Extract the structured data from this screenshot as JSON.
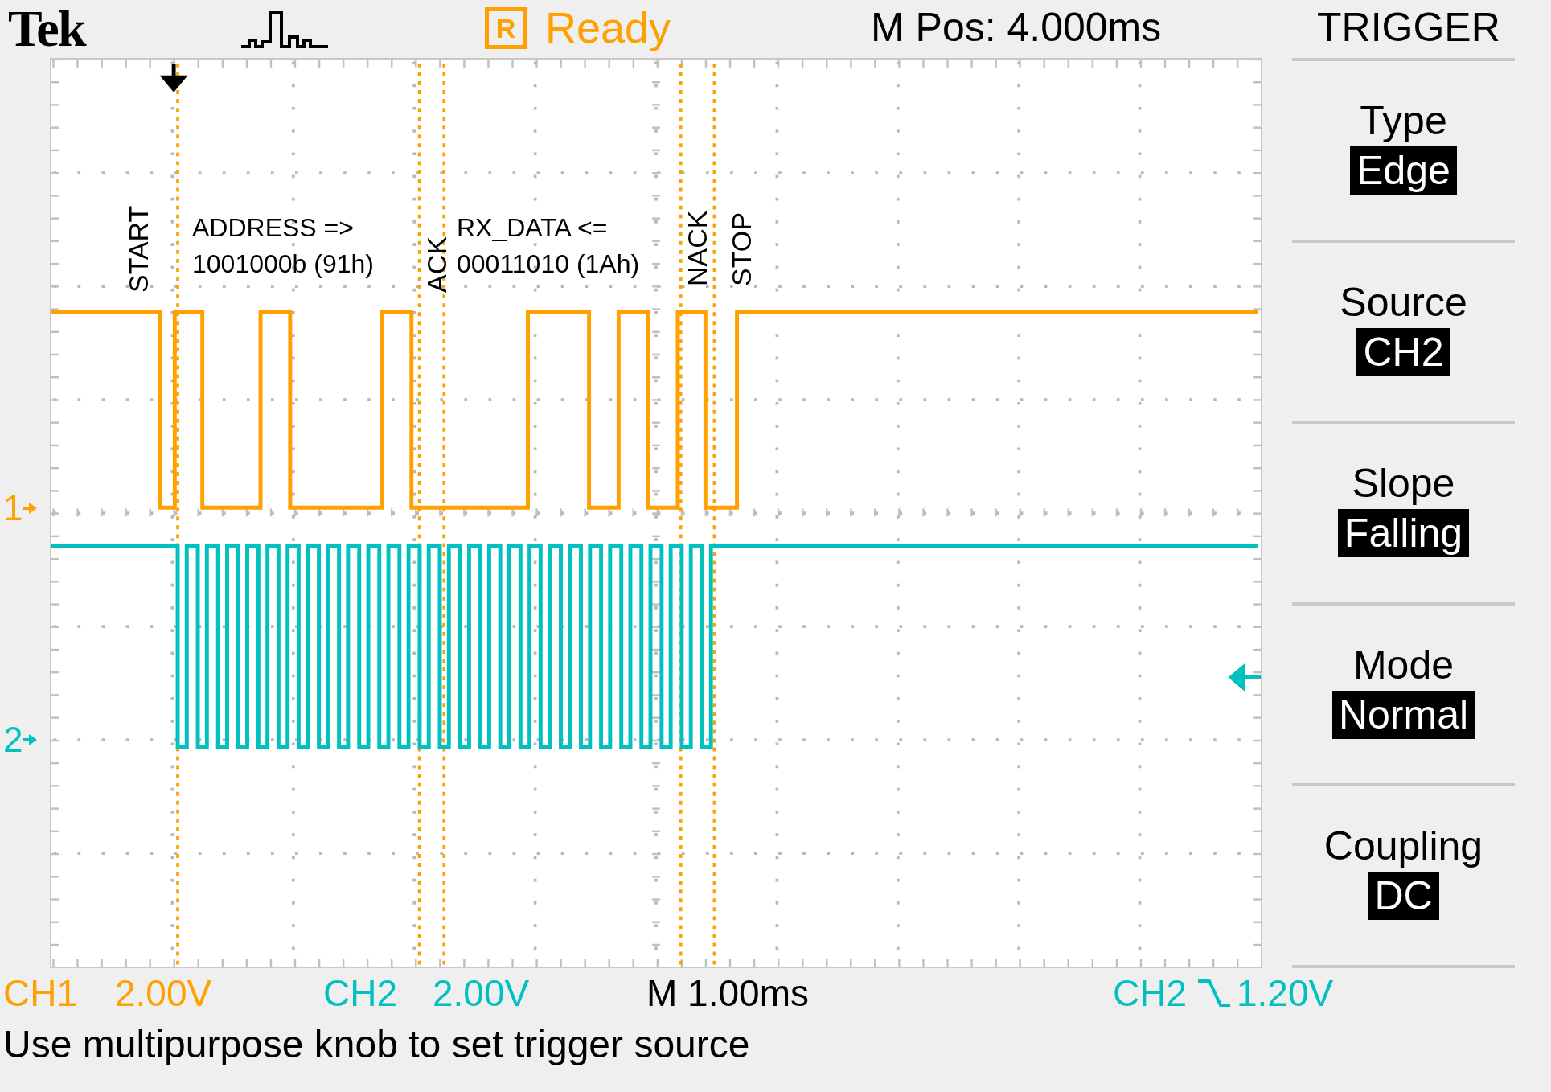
{
  "header": {
    "brand": "Tek",
    "run_badge": "R",
    "status": "Ready",
    "position": "M Pos: 4.000ms",
    "menu_title": "TRIGGER"
  },
  "annotations": [
    {
      "kind": "vertical",
      "lines": [
        "START"
      ]
    },
    {
      "kind": "horizontal",
      "lines": [
        "ADDRESS =>",
        "1001000b (91h)"
      ]
    },
    {
      "kind": "vertical",
      "lines": [
        "ACK"
      ]
    },
    {
      "kind": "horizontal",
      "lines": [
        "RX_DATA <=",
        "00011010 (1Ah)"
      ]
    },
    {
      "kind": "vertical",
      "lines": [
        "NACK"
      ]
    },
    {
      "kind": "vertical",
      "lines": [
        "STOP"
      ]
    }
  ],
  "channel_markers": [
    {
      "label": "1",
      "color": "#ffa000"
    },
    {
      "label": "2",
      "color": "#00c0c0"
    }
  ],
  "menu": [
    {
      "label": "Type",
      "value": "Edge"
    },
    {
      "label": "Source",
      "value": "CH2"
    },
    {
      "label": "Slope",
      "value": "Falling"
    },
    {
      "label": "Mode",
      "value": "Normal"
    },
    {
      "label": "Coupling",
      "value": "DC"
    }
  ],
  "readouts": [
    {
      "kind": "scale",
      "channel": "CH1",
      "value": "2.00V",
      "color": "#ffa000"
    },
    {
      "kind": "scale",
      "channel": "CH2",
      "value": "2.00V",
      "color": "#00c0c0"
    },
    {
      "kind": "timebase",
      "value": "M 1.00ms",
      "color": "#000000"
    },
    {
      "kind": "trigger",
      "channel": "CH2",
      "value": "1.20V",
      "color": "#00c0c0"
    }
  ],
  "message": "Use multipurpose knob to set trigger source"
}
